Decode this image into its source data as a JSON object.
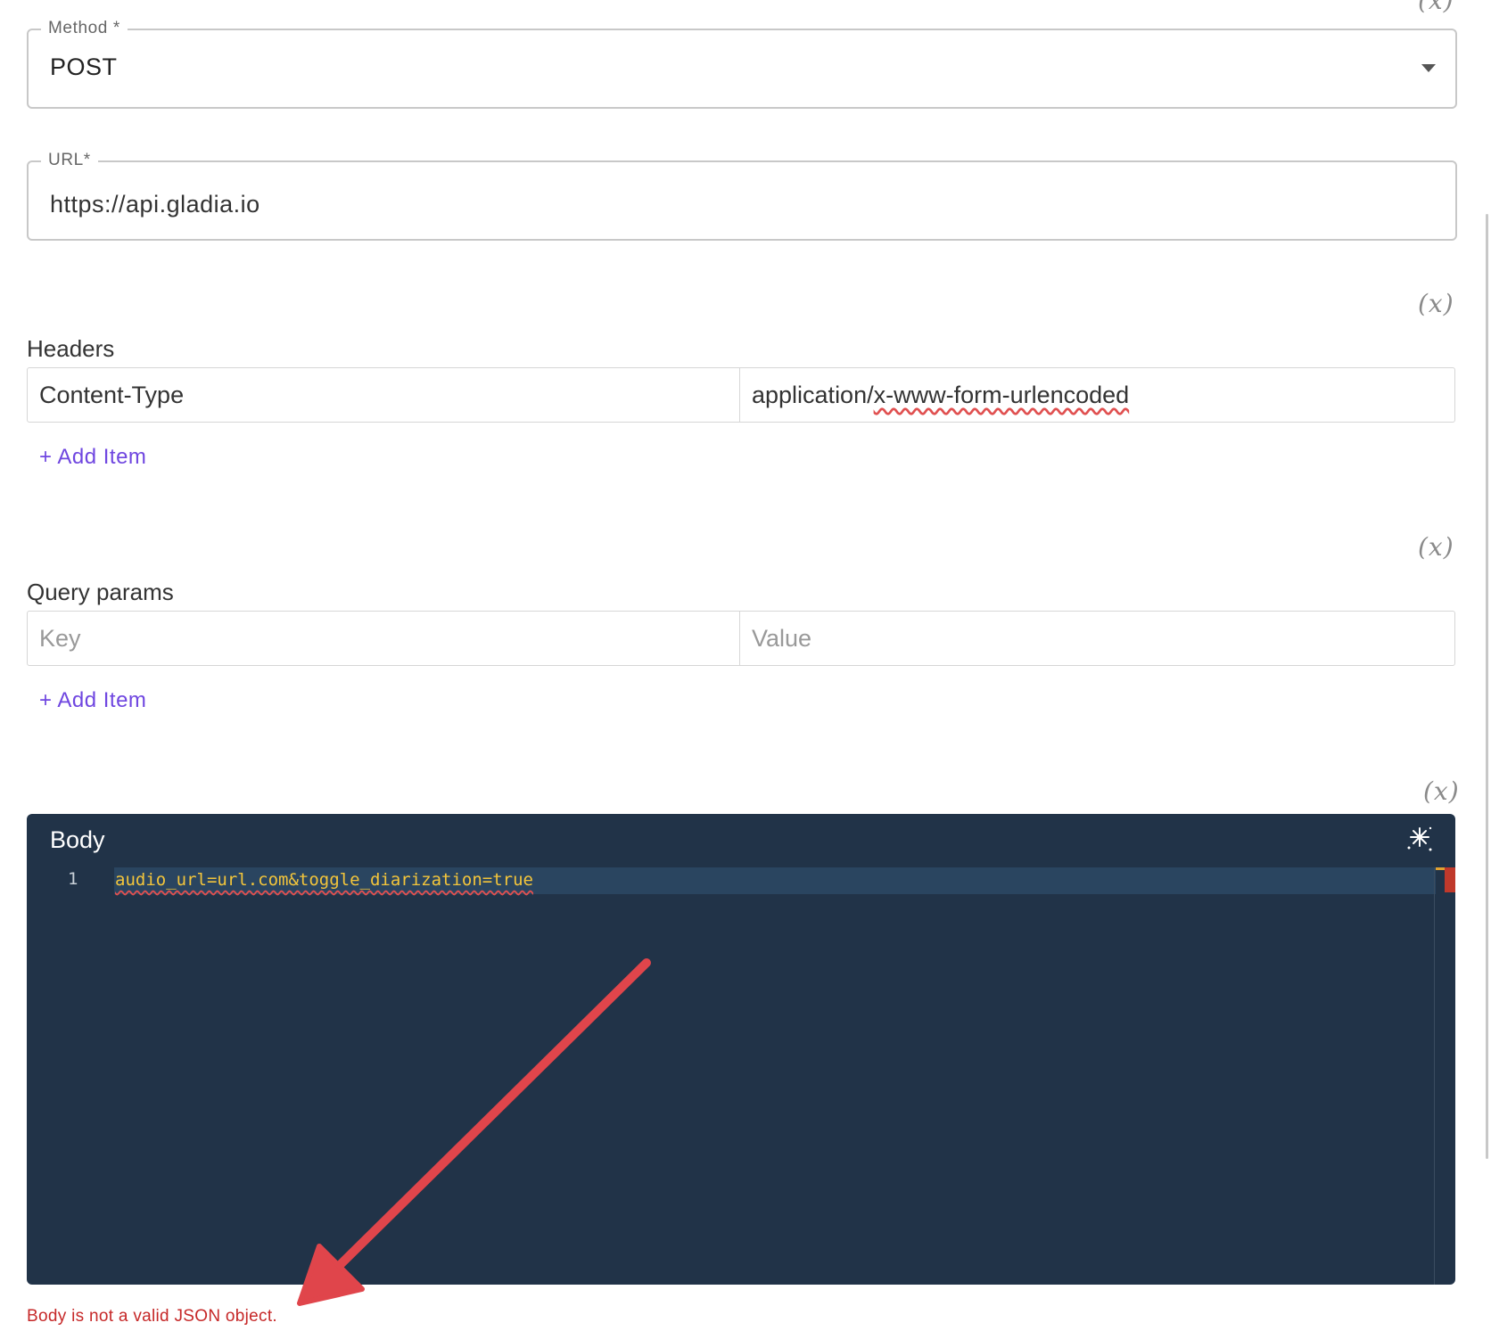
{
  "variable_toggle": "(x)",
  "method": {
    "label": "Method *",
    "value": "POST"
  },
  "url": {
    "label": "URL*",
    "value": "https://api.gladia.io"
  },
  "headers": {
    "title": "Headers",
    "rows": [
      {
        "key": "Content-Type",
        "value_prefix": "application/",
        "value_flagged": "x-www-form-urlencoded"
      }
    ],
    "add_label": "+ Add Item"
  },
  "query_params": {
    "title": "Query params",
    "key_placeholder": "Key",
    "value_placeholder": "Value",
    "add_label": "+ Add Item"
  },
  "body": {
    "title": "Body",
    "line_number": "1",
    "code": "audio_url=url.com&toggle_diarization=true",
    "error": "Body is not a valid JSON object."
  },
  "colors": {
    "accent": "#6f46e0",
    "editor_bg": "#213348",
    "code_text": "#f3c53b",
    "error": "#c62828",
    "annotation_arrow": "#e0454b"
  },
  "icons": {
    "dropdown": "caret-down-icon",
    "format": "magic-wand-icon"
  }
}
